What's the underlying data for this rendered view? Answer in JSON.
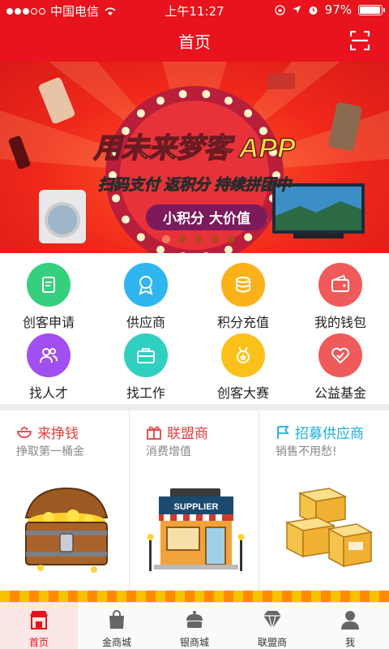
{
  "status_bar": {
    "carrier": "中国电信",
    "time": "上午11:27",
    "battery": "97%",
    "battery_level": 0.97
  },
  "header": {
    "title": "首页"
  },
  "banner": {
    "headline": "用未来梦客 APP",
    "subline": "扫码支付 返积分 持续拼团中",
    "tag": "小积分 大价值"
  },
  "grid": [
    {
      "label": "创客申请",
      "icon": "apply-icon",
      "color": "#35d07d"
    },
    {
      "label": "供应商",
      "icon": "badge-icon",
      "color": "#2fb6f0"
    },
    {
      "label": "积分充值",
      "icon": "coins-icon",
      "color": "#fbb21a"
    },
    {
      "label": "我的钱包",
      "icon": "wallet-icon",
      "color": "#f05a5a"
    },
    {
      "label": "找人才",
      "icon": "people-icon",
      "color": "#a14ff0"
    },
    {
      "label": "找工作",
      "icon": "briefcase-icon",
      "color": "#2fd0c0"
    },
    {
      "label": "创客大赛",
      "icon": "medal-icon",
      "color": "#fbc11a"
    },
    {
      "label": "公益基金",
      "icon": "heart-icon",
      "color": "#f05a5a"
    }
  ],
  "cards": [
    {
      "title": "来挣钱",
      "subtitle": "挣取第一桶金",
      "color": "#e83f3f",
      "icon": "bowl-icon"
    },
    {
      "title": "联盟商",
      "subtitle": "消费增值",
      "color": "#e83f3f",
      "icon": "gift-icon"
    },
    {
      "title": "招募供应商",
      "subtitle": "销售不用愁!",
      "color": "#1bb0e0",
      "icon": "flag-icon"
    }
  ],
  "store_sign": "SUPPLIER",
  "tabs": [
    {
      "label": "首页",
      "icon": "home-store-icon",
      "active": true
    },
    {
      "label": "金商城",
      "icon": "bag-icon",
      "active": false
    },
    {
      "label": "银商城",
      "icon": "cake-icon",
      "active": false
    },
    {
      "label": "联盟商",
      "icon": "diamond-icon",
      "active": false
    },
    {
      "label": "我",
      "icon": "person-icon",
      "active": false
    }
  ]
}
